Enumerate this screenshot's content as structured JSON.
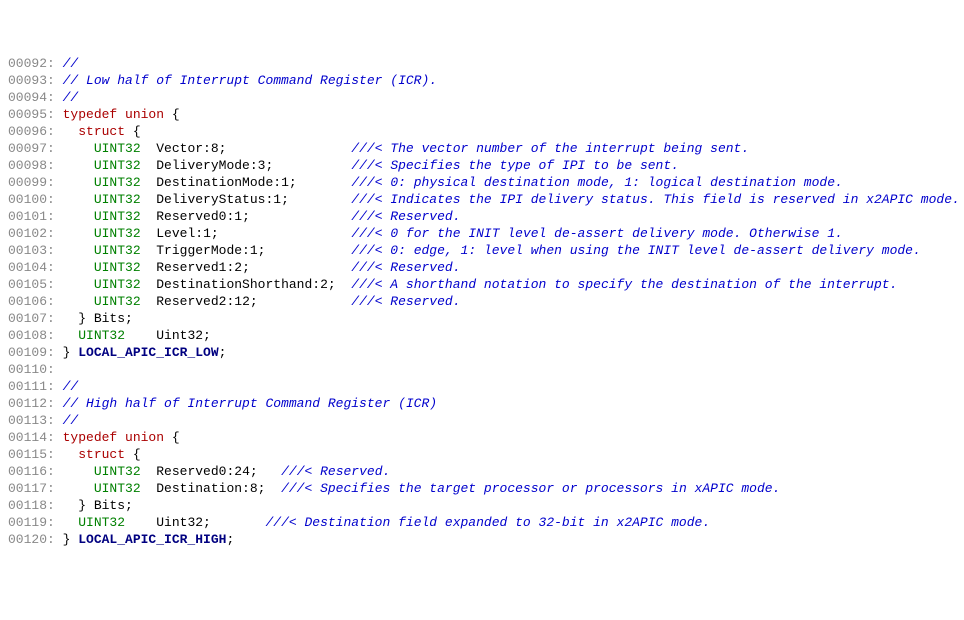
{
  "lines": [
    {
      "n": "00092",
      "segs": [
        {
          "c": "lineno",
          "t": "00092: "
        },
        {
          "c": "comment",
          "t": "//"
        }
      ]
    },
    {
      "n": "00093",
      "segs": [
        {
          "c": "lineno",
          "t": "00093: "
        },
        {
          "c": "comment",
          "t": "// Low half of Interrupt Command Register (ICR)."
        }
      ]
    },
    {
      "n": "00094",
      "segs": [
        {
          "c": "lineno",
          "t": "00094: "
        },
        {
          "c": "comment",
          "t": "//"
        }
      ]
    },
    {
      "n": "00095",
      "segs": [
        {
          "c": "lineno",
          "t": "00095: "
        },
        {
          "c": "kw",
          "t": "typedef"
        },
        {
          "c": "ident",
          "t": " "
        },
        {
          "c": "kw",
          "t": "union"
        },
        {
          "c": "ident",
          "t": " {"
        }
      ]
    },
    {
      "n": "00096",
      "segs": [
        {
          "c": "lineno",
          "t": "00096: "
        },
        {
          "c": "ident",
          "t": "  "
        },
        {
          "c": "kw",
          "t": "struct"
        },
        {
          "c": "ident",
          "t": " {"
        }
      ]
    },
    {
      "n": "00097",
      "segs": [
        {
          "c": "lineno",
          "t": "00097: "
        },
        {
          "c": "ident",
          "t": "    "
        },
        {
          "c": "type",
          "t": "UINT32"
        },
        {
          "c": "ident",
          "t": "  Vector:"
        },
        {
          "c": "num",
          "t": "8"
        },
        {
          "c": "ident",
          "t": ";                "
        },
        {
          "c": "comment",
          "t": "///< The vector number of the interrupt being sent."
        }
      ]
    },
    {
      "n": "00098",
      "segs": [
        {
          "c": "lineno",
          "t": "00098: "
        },
        {
          "c": "ident",
          "t": "    "
        },
        {
          "c": "type",
          "t": "UINT32"
        },
        {
          "c": "ident",
          "t": "  DeliveryMode:"
        },
        {
          "c": "num",
          "t": "3"
        },
        {
          "c": "ident",
          "t": ";          "
        },
        {
          "c": "comment",
          "t": "///< Specifies the type of IPI to be sent."
        }
      ]
    },
    {
      "n": "00099",
      "segs": [
        {
          "c": "lineno",
          "t": "00099: "
        },
        {
          "c": "ident",
          "t": "    "
        },
        {
          "c": "type",
          "t": "UINT32"
        },
        {
          "c": "ident",
          "t": "  DestinationMode:"
        },
        {
          "c": "num",
          "t": "1"
        },
        {
          "c": "ident",
          "t": ";       "
        },
        {
          "c": "comment",
          "t": "///< 0: physical destination mode, 1: logical destination mode."
        }
      ]
    },
    {
      "n": "00100",
      "segs": [
        {
          "c": "lineno",
          "t": "00100: "
        },
        {
          "c": "ident",
          "t": "    "
        },
        {
          "c": "type",
          "t": "UINT32"
        },
        {
          "c": "ident",
          "t": "  DeliveryStatus:"
        },
        {
          "c": "num",
          "t": "1"
        },
        {
          "c": "ident",
          "t": ";        "
        },
        {
          "c": "comment",
          "t": "///< Indicates the IPI delivery status. This field is reserved in x2APIC mode."
        }
      ]
    },
    {
      "n": "00101",
      "segs": [
        {
          "c": "lineno",
          "t": "00101: "
        },
        {
          "c": "ident",
          "t": "    "
        },
        {
          "c": "type",
          "t": "UINT32"
        },
        {
          "c": "ident",
          "t": "  Reserved0:"
        },
        {
          "c": "num",
          "t": "1"
        },
        {
          "c": "ident",
          "t": ";             "
        },
        {
          "c": "comment",
          "t": "///< Reserved."
        }
      ]
    },
    {
      "n": "00102",
      "segs": [
        {
          "c": "lineno",
          "t": "00102: "
        },
        {
          "c": "ident",
          "t": "    "
        },
        {
          "c": "type",
          "t": "UINT32"
        },
        {
          "c": "ident",
          "t": "  Level:"
        },
        {
          "c": "num",
          "t": "1"
        },
        {
          "c": "ident",
          "t": ";                 "
        },
        {
          "c": "comment",
          "t": "///< 0 for the INIT level de-assert delivery mode. Otherwise 1."
        }
      ]
    },
    {
      "n": "00103",
      "segs": [
        {
          "c": "lineno",
          "t": "00103: "
        },
        {
          "c": "ident",
          "t": "    "
        },
        {
          "c": "type",
          "t": "UINT32"
        },
        {
          "c": "ident",
          "t": "  TriggerMode:"
        },
        {
          "c": "num",
          "t": "1"
        },
        {
          "c": "ident",
          "t": ";           "
        },
        {
          "c": "comment",
          "t": "///< 0: edge, 1: level when using the INIT level de-assert delivery mode."
        }
      ]
    },
    {
      "n": "00104",
      "segs": [
        {
          "c": "lineno",
          "t": "00104: "
        },
        {
          "c": "ident",
          "t": "    "
        },
        {
          "c": "type",
          "t": "UINT32"
        },
        {
          "c": "ident",
          "t": "  Reserved1:"
        },
        {
          "c": "num",
          "t": "2"
        },
        {
          "c": "ident",
          "t": ";             "
        },
        {
          "c": "comment",
          "t": "///< Reserved."
        }
      ]
    },
    {
      "n": "00105",
      "segs": [
        {
          "c": "lineno",
          "t": "00105: "
        },
        {
          "c": "ident",
          "t": "    "
        },
        {
          "c": "type",
          "t": "UINT32"
        },
        {
          "c": "ident",
          "t": "  DestinationShorthand:"
        },
        {
          "c": "num",
          "t": "2"
        },
        {
          "c": "ident",
          "t": ";  "
        },
        {
          "c": "comment",
          "t": "///< A shorthand notation to specify the destination of the interrupt."
        }
      ]
    },
    {
      "n": "00106",
      "segs": [
        {
          "c": "lineno",
          "t": "00106: "
        },
        {
          "c": "ident",
          "t": "    "
        },
        {
          "c": "type",
          "t": "UINT32"
        },
        {
          "c": "ident",
          "t": "  Reserved2:"
        },
        {
          "c": "num",
          "t": "12"
        },
        {
          "c": "ident",
          "t": ";            "
        },
        {
          "c": "comment",
          "t": "///< Reserved."
        }
      ]
    },
    {
      "n": "00107",
      "segs": [
        {
          "c": "lineno",
          "t": "00107: "
        },
        {
          "c": "ident",
          "t": "  } Bits;"
        }
      ]
    },
    {
      "n": "00108",
      "segs": [
        {
          "c": "lineno",
          "t": "00108: "
        },
        {
          "c": "ident",
          "t": "  "
        },
        {
          "c": "type",
          "t": "UINT32"
        },
        {
          "c": "ident",
          "t": "    Uint32;"
        }
      ]
    },
    {
      "n": "00109",
      "segs": [
        {
          "c": "lineno",
          "t": "00109: "
        },
        {
          "c": "ident",
          "t": "} "
        },
        {
          "c": "strong",
          "t": "LOCAL_APIC_ICR_LOW"
        },
        {
          "c": "ident",
          "t": ";"
        }
      ]
    },
    {
      "n": "00110",
      "segs": [
        {
          "c": "lineno",
          "t": "00110: "
        }
      ]
    },
    {
      "n": "00111",
      "segs": [
        {
          "c": "lineno",
          "t": "00111: "
        },
        {
          "c": "comment",
          "t": "//"
        }
      ]
    },
    {
      "n": "00112",
      "segs": [
        {
          "c": "lineno",
          "t": "00112: "
        },
        {
          "c": "comment",
          "t": "// High half of Interrupt Command Register (ICR)"
        }
      ]
    },
    {
      "n": "00113",
      "segs": [
        {
          "c": "lineno",
          "t": "00113: "
        },
        {
          "c": "comment",
          "t": "//"
        }
      ]
    },
    {
      "n": "00114",
      "segs": [
        {
          "c": "lineno",
          "t": "00114: "
        },
        {
          "c": "kw",
          "t": "typedef"
        },
        {
          "c": "ident",
          "t": " "
        },
        {
          "c": "kw",
          "t": "union"
        },
        {
          "c": "ident",
          "t": " {"
        }
      ]
    },
    {
      "n": "00115",
      "segs": [
        {
          "c": "lineno",
          "t": "00115: "
        },
        {
          "c": "ident",
          "t": "  "
        },
        {
          "c": "kw",
          "t": "struct"
        },
        {
          "c": "ident",
          "t": " {"
        }
      ]
    },
    {
      "n": "00116",
      "segs": [
        {
          "c": "lineno",
          "t": "00116: "
        },
        {
          "c": "ident",
          "t": "    "
        },
        {
          "c": "type",
          "t": "UINT32"
        },
        {
          "c": "ident",
          "t": "  Reserved0:"
        },
        {
          "c": "num",
          "t": "24"
        },
        {
          "c": "ident",
          "t": ";   "
        },
        {
          "c": "comment",
          "t": "///< Reserved."
        }
      ]
    },
    {
      "n": "00117",
      "segs": [
        {
          "c": "lineno",
          "t": "00117: "
        },
        {
          "c": "ident",
          "t": "    "
        },
        {
          "c": "type",
          "t": "UINT32"
        },
        {
          "c": "ident",
          "t": "  Destination:"
        },
        {
          "c": "num",
          "t": "8"
        },
        {
          "c": "ident",
          "t": ";  "
        },
        {
          "c": "comment",
          "t": "///< Specifies the target processor or processors in xAPIC mode."
        }
      ]
    },
    {
      "n": "00118",
      "segs": [
        {
          "c": "lineno",
          "t": "00118: "
        },
        {
          "c": "ident",
          "t": "  } Bits;"
        }
      ]
    },
    {
      "n": "00119",
      "segs": [
        {
          "c": "lineno",
          "t": "00119: "
        },
        {
          "c": "ident",
          "t": "  "
        },
        {
          "c": "type",
          "t": "UINT32"
        },
        {
          "c": "ident",
          "t": "    Uint32;       "
        },
        {
          "c": "comment",
          "t": "///< Destination field expanded to 32-bit in x2APIC mode."
        }
      ]
    },
    {
      "n": "00120",
      "segs": [
        {
          "c": "lineno",
          "t": "00120: "
        },
        {
          "c": "ident",
          "t": "} "
        },
        {
          "c": "strong",
          "t": "LOCAL_APIC_ICR_HIGH"
        },
        {
          "c": "ident",
          "t": ";"
        }
      ]
    }
  ]
}
